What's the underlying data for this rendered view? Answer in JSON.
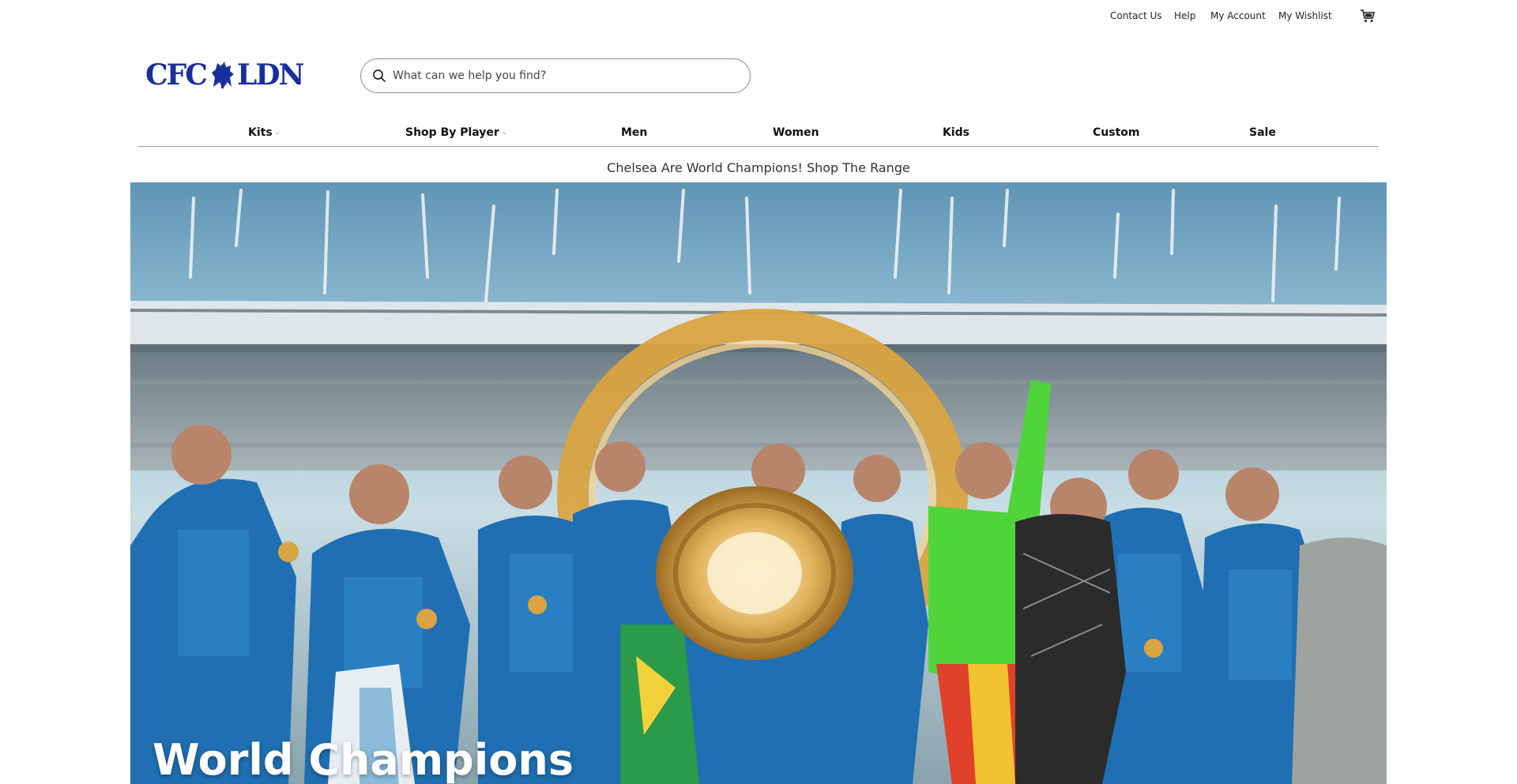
{
  "utility_nav": {
    "contact": "Contact Us",
    "help": "Help",
    "account": "My Account",
    "wishlist": "My Wishlist",
    "cart_icon": "cart-icon"
  },
  "logo": {
    "left": "CFC",
    "right": "LDN",
    "crest_icon": "chelsea-lion-icon"
  },
  "search": {
    "placeholder": "What can we help you find?",
    "value": "",
    "icon": "search-icon"
  },
  "main_nav": {
    "items": [
      {
        "label": "Kits",
        "has_dropdown": true
      },
      {
        "label": "Shop By Player",
        "has_dropdown": true
      },
      {
        "label": "Men",
        "has_dropdown": false
      },
      {
        "label": "Women",
        "has_dropdown": false
      },
      {
        "label": "Kids",
        "has_dropdown": false
      },
      {
        "label": "Custom",
        "has_dropdown": false
      },
      {
        "label": "Sale",
        "has_dropdown": false
      }
    ]
  },
  "promo_banner": {
    "text": "Chelsea Are World Champions! Shop The Range"
  },
  "hero": {
    "title": "World Champions"
  },
  "colors": {
    "brand_blue": "#1a2f9c",
    "kit_blue": "#1f6fb2",
    "sky": "#7fb4cf",
    "trophy_gold": "#d9a441",
    "keeper_green": "#4fd43a"
  }
}
